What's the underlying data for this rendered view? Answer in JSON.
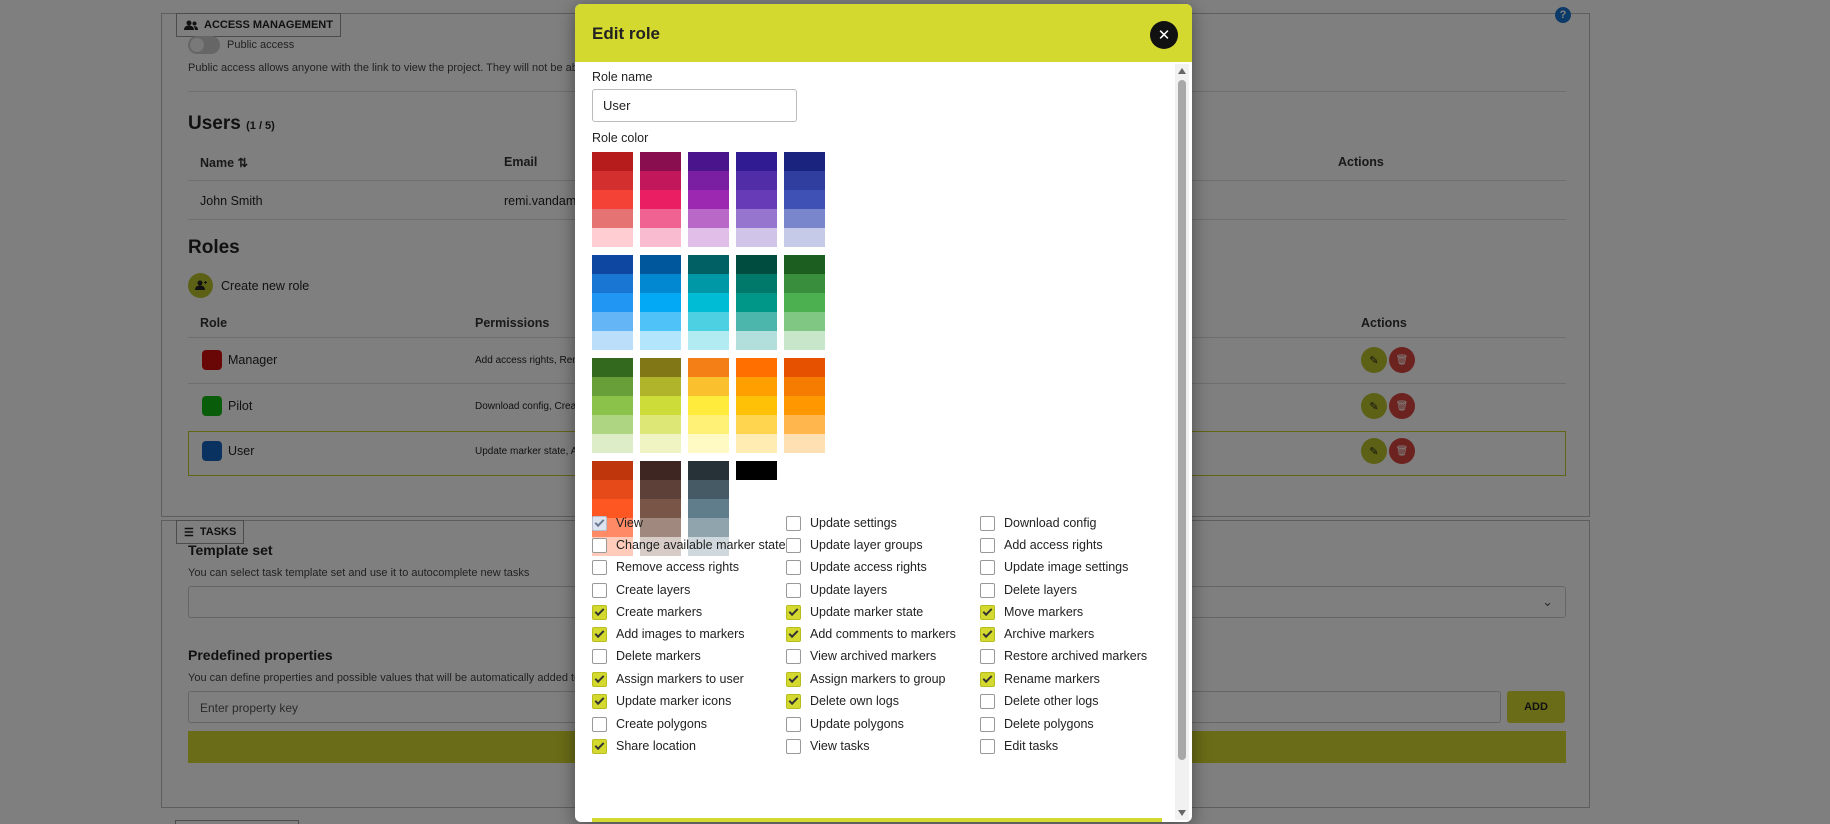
{
  "background": {
    "access": {
      "legend": "ACCESS MANAGEMENT",
      "public_access_label": "Public access",
      "public_access_desc": "Public access allows anyone with the link to view the project. They will not be able to m"
    },
    "users": {
      "title": "Users",
      "count": "(1 / 5)",
      "col_name": "Name",
      "col_email": "Email",
      "col_actions": "Actions",
      "rows": [
        {
          "name": "John Smith",
          "email": "remi.vandame"
        }
      ]
    },
    "roles": {
      "title": "Roles",
      "create_label": "Create new role",
      "col_role": "Role",
      "col_permissions": "Permissions",
      "col_actions": "Actions",
      "rows": [
        {
          "name": "Manager",
          "color": "#d20f0f",
          "perms": "Add access rights, Remo"
        },
        {
          "name": "Pilot",
          "color": "#12b912",
          "perms": "Download config, Create"
        },
        {
          "name": "User",
          "color": "#1565c0",
          "perms": "Update marker state, Add"
        }
      ]
    },
    "tasks": {
      "legend": "TASKS",
      "template_title": "Template set",
      "template_desc": "You can select task template set and use it to autocomplete new tasks",
      "predefined_title": "Predefined properties",
      "predefined_desc": "You can define properties and possible values that will be automatically added to new ta",
      "property_placeholder": "Enter property key",
      "add_label": "ADD"
    }
  },
  "modal": {
    "title": "Edit role",
    "role_name_label": "Role name",
    "role_name_value": "User",
    "role_color_label": "Role color",
    "swatch_blocks": [
      [
        [
          "#b71c1c",
          "#d32f2f",
          "#f44336",
          "#e57373",
          "#ffcdd2"
        ],
        [
          "#880e4f",
          "#c2185b",
          "#e91e63",
          "#f06292",
          "#f8bbd0"
        ],
        [
          "#4a148c",
          "#7b1fa2",
          "#9c27b0",
          "#ba68c8",
          "#e1bee7"
        ],
        [
          "#311b92",
          "#512da8",
          "#673ab7",
          "#9575cd",
          "#d1c4e9"
        ],
        [
          "#1a237e",
          "#303f9f",
          "#3f51b5",
          "#7986cb",
          "#c5cae9"
        ]
      ],
      [
        [
          "#0d47a1",
          "#1976d2",
          "#2196f3",
          "#64b5f6",
          "#bbdefb"
        ],
        [
          "#01579b",
          "#0288d1",
          "#03a9f4",
          "#4fc3f7",
          "#b3e5fc"
        ],
        [
          "#006064",
          "#0097a7",
          "#00bcd4",
          "#4dd0e1",
          "#b2ebf2"
        ],
        [
          "#004d40",
          "#00796b",
          "#009688",
          "#4db6ac",
          "#b2dfdb"
        ],
        [
          "#1b5e20",
          "#388e3c",
          "#4caf50",
          "#81c784",
          "#c8e6c9"
        ]
      ],
      [
        [
          "#33691e",
          "#689f38",
          "#8bc34a",
          "#aed581",
          "#dcedc8"
        ],
        [
          "#827717",
          "#afb42b",
          "#cddc39",
          "#dce775",
          "#f0f4c3"
        ],
        [
          "#f57f17",
          "#fbc02d",
          "#ffeb3b",
          "#fff176",
          "#fff9c4"
        ],
        [
          "#ff6f00",
          "#ffa000",
          "#ffc107",
          "#ffd54f",
          "#ffecb3"
        ],
        [
          "#e65100",
          "#f57c00",
          "#ff9800",
          "#ffb74d",
          "#ffe0b2"
        ]
      ],
      [
        [
          "#bf360c",
          "#e64a19",
          "#ff5722",
          "#ff8a65",
          "#ffccbc"
        ],
        [
          "#3e2723",
          "#5d4037",
          "#795548",
          "#a1887f",
          "#d7ccc8"
        ],
        [
          "#263238",
          "#455a64",
          "#607d8b",
          "#90a4ae",
          "#cfd8dc"
        ],
        [
          "#000000"
        ]
      ]
    ],
    "permissions": [
      [
        {
          "label": "View",
          "checked": true,
          "disabled": true
        },
        {
          "label": "Change available marker states",
          "checked": false
        },
        {
          "label": "Remove access rights",
          "checked": false
        },
        {
          "label": "Create layers",
          "checked": false
        },
        {
          "label": "Create markers",
          "checked": true
        },
        {
          "label": "Add images to markers",
          "checked": true
        },
        {
          "label": "Delete markers",
          "checked": false
        },
        {
          "label": "Assign markers to user",
          "checked": true
        },
        {
          "label": "Update marker icons",
          "checked": true
        },
        {
          "label": "Create polygons",
          "checked": false
        },
        {
          "label": "Share location",
          "checked": true
        }
      ],
      [
        {
          "label": "Update settings",
          "checked": false
        },
        {
          "label": "Update layer groups",
          "checked": false
        },
        {
          "label": "Update access rights",
          "checked": false
        },
        {
          "label": "Update layers",
          "checked": false
        },
        {
          "label": "Update marker state",
          "checked": true
        },
        {
          "label": "Add comments to markers",
          "checked": true
        },
        {
          "label": "View archived markers",
          "checked": false
        },
        {
          "label": "Assign markers to group",
          "checked": true
        },
        {
          "label": "Delete own logs",
          "checked": true
        },
        {
          "label": "Update polygons",
          "checked": false
        },
        {
          "label": "View tasks",
          "checked": false
        }
      ],
      [
        {
          "label": "Download config",
          "checked": false
        },
        {
          "label": "Add access rights",
          "checked": false
        },
        {
          "label": "Update image settings",
          "checked": false
        },
        {
          "label": "Delete layers",
          "checked": false
        },
        {
          "label": "Move markers",
          "checked": true
        },
        {
          "label": "Archive markers",
          "checked": true
        },
        {
          "label": "Restore archived markers",
          "checked": false
        },
        {
          "label": "Rename markers",
          "checked": true
        },
        {
          "label": "Delete other logs",
          "checked": false
        },
        {
          "label": "Delete polygons",
          "checked": false
        },
        {
          "label": "Edit tasks",
          "checked": false
        }
      ]
    ]
  },
  "colors": {
    "accent": "#d4d92f",
    "overlay": "rgba(0,0,0,0.5)",
    "delete": "#d9443c"
  }
}
